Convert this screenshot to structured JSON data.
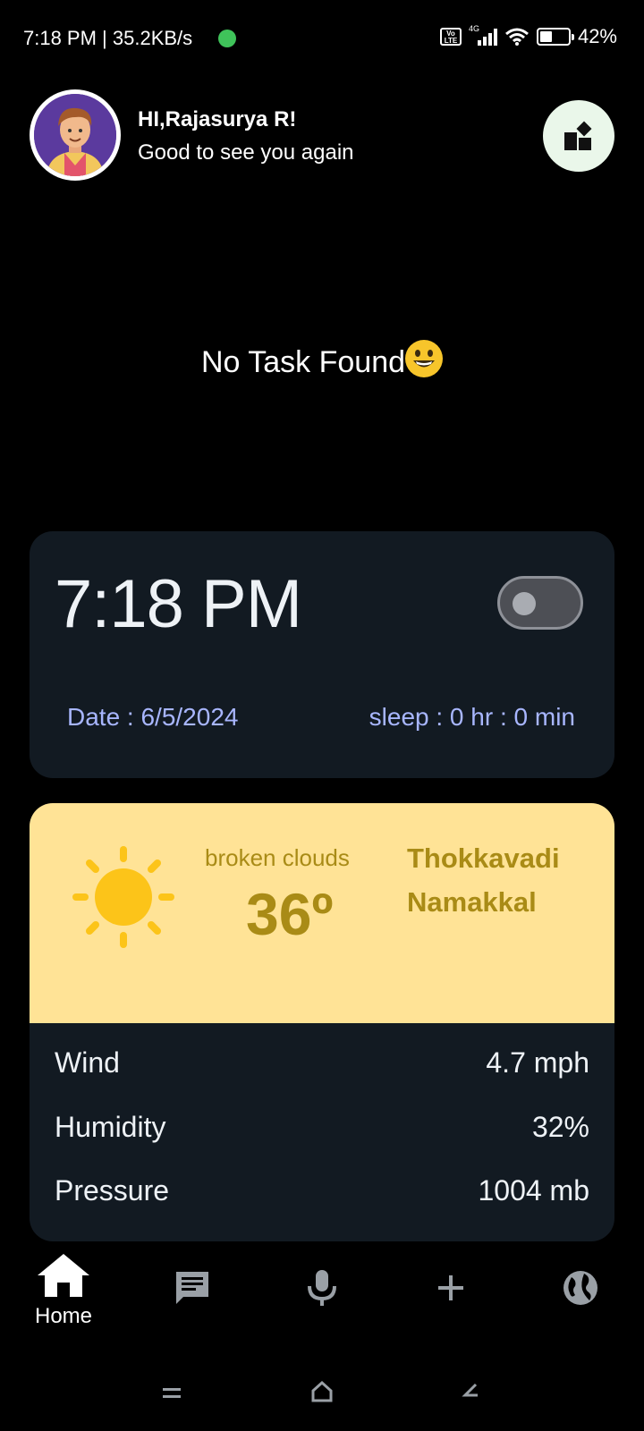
{
  "status_bar": {
    "time": "7:18 PM",
    "speed": "35.2KB/s",
    "network": "4G",
    "volte": "Vo LTE",
    "battery": "42%",
    "battery_level": 0.42
  },
  "header": {
    "greeting": "HI,Rajasurya R!",
    "subtitle": "Good to see you again",
    "avatar_icon": "user-avatar",
    "widget_icon": "widgets-icon"
  },
  "empty_state": {
    "message": "No Task Found",
    "emoji_icon": "grinning-face-icon"
  },
  "clock_card": {
    "time": "7:18 PM",
    "date": "Date : 6/5/2024",
    "sleep": "sleep : 0 hr : 0 min",
    "toggle_on": false
  },
  "weather": {
    "condition": "broken clouds",
    "temperature": "36º",
    "location_line1": "Thokkavadi",
    "location_line2": "Namakkal",
    "icon": "sun-icon",
    "details": [
      {
        "label": "Wind",
        "value": "4.7 mph"
      },
      {
        "label": "Humidity",
        "value": "32%"
      },
      {
        "label": "Pressure",
        "value": "1004 mb"
      }
    ],
    "colors": {
      "banner": "#ffe396",
      "text": "#a98b16",
      "card": "#121a22"
    }
  },
  "bottom_nav": {
    "items": [
      {
        "label": "Home",
        "icon": "home-icon",
        "active": true
      },
      {
        "label": "",
        "icon": "chat-icon",
        "active": false
      },
      {
        "label": "",
        "icon": "mic-icon",
        "active": false
      },
      {
        "label": "",
        "icon": "plus-icon",
        "active": false
      },
      {
        "label": "",
        "icon": "globe-icon",
        "active": false
      }
    ]
  },
  "system_nav": {
    "items": [
      "recents-icon",
      "home-outline-icon",
      "back-icon"
    ]
  }
}
